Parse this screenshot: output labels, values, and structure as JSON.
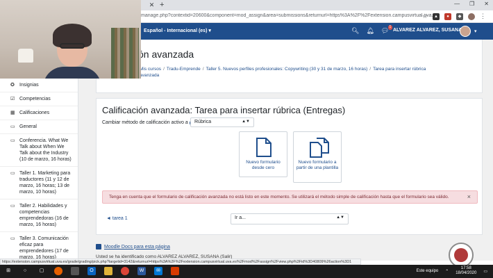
{
  "browser": {
    "url": "manage.php?contextid=20600&component=mod_assign&area=submissions&returnurl=https%3A%2F%2Fextension.campusvirtual.uva.es%2Fm...",
    "new_tab_symbol": "+",
    "close_tab_symbol": "✕"
  },
  "navbar": {
    "language": "Español - Internacional (es)",
    "user_name": "ALVAREZ ALVAREZ, SUSANA",
    "notification_count": "1",
    "brand_color": "#1f4e8c"
  },
  "page": {
    "heading": "ón avanzada",
    "breadcrumb": [
      "Mis cursos",
      "Tradu-Emprende",
      "Taller 5. Nuevos perfiles profesionales: Copywriting (30 y 31 de marzo, 16 horas)",
      "Tarea para insertar rúbrica",
      "avanzada"
    ]
  },
  "drawer": {
    "items": [
      {
        "icon": "badge-icon",
        "label": "Insignias"
      },
      {
        "icon": "check-square-icon",
        "label": "Competencias"
      },
      {
        "icon": "table-icon",
        "label": "Calificaciones"
      },
      {
        "icon": "folder-icon",
        "label": "General"
      },
      {
        "icon": "folder-icon",
        "label": "Conferencia. What We Talk about When We Talk about the Industry (10 de marzo, 16 horas)"
      },
      {
        "icon": "folder-icon",
        "label": "Taller 1. Marketing para traductores (11 y 12 de marzo, 16 horas; 13 de marzo, 10 horas)"
      },
      {
        "icon": "folder-icon",
        "label": "Taller 2. Habilidades y competencias emprendedoras (16 de marzo, 16 horas)"
      },
      {
        "icon": "folder-icon",
        "label": "Taller 3. Comunicación eficaz para emprendedores (17 de marzo, 16 horas)"
      }
    ]
  },
  "grading": {
    "title": "Calificación avanzada: Tarea para insertar rúbrica (Entregas)",
    "method_label": "Cambiar método de calificación activo a",
    "method_value": "Rúbrica",
    "option_new": "Nuevo formulario desde cero",
    "option_template": "Nuevo formulario a partir de una plantilla",
    "alert": "Tenga en cuenta que el formulario de calificación avanzada no está listo en este momento. Se utilizará el método simple de calificación hasta que el formulario sea válido.",
    "alert_close": "×",
    "prev_link": "◄ tarea 1",
    "jump_value": "Ir a..."
  },
  "footer": {
    "docs_link": "Moodle Docs para esta página",
    "logged_text": "Usted se ha identificado como ALVAREZ ALVAREZ, SUSANA (Salir)"
  },
  "statusbar": {
    "text": "https://extension.campusvirtual.uva.es/grade/grading/pick.php?targetid=3142&returnurl=https%3A%2F%2Fextension.campusvirtual.uva.es%2Fmod%2Fassign%2Fview.php%3Fid%3D40809%26action%3D1"
  },
  "taskbar": {
    "network_label": "Este equipo",
    "time": "17:58",
    "date": "18/04/2020"
  }
}
